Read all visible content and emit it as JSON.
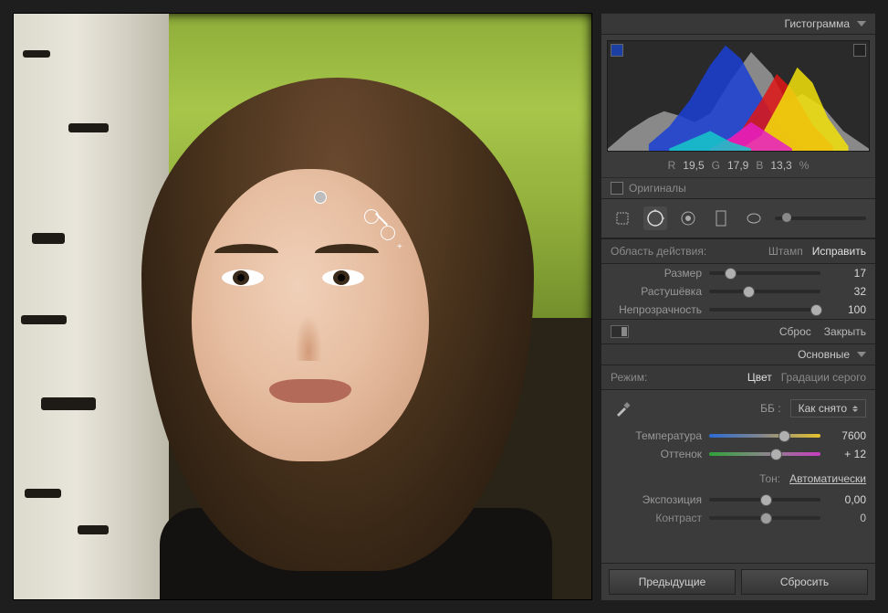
{
  "histogram": {
    "title": "Гистограмма",
    "readout": {
      "r_label": "R",
      "r": "19,5",
      "g_label": "G",
      "g": "17,9",
      "b_label": "B",
      "b": "13,3",
      "unit": "%"
    },
    "originals_label": "Оригиналы"
  },
  "tools": {
    "crop": "crop-tool",
    "spot": "spot-removal-tool",
    "redeye": "red-eye-tool",
    "grad": "graduated-filter-tool",
    "radial": "radial-filter-tool",
    "brush": "adjustment-brush-tool"
  },
  "spot_panel": {
    "scope_label": "Область действия:",
    "mode_clone": "Штамп",
    "mode_heal": "Исправить",
    "size_label": "Размер",
    "size_value": "17",
    "feather_label": "Растушёвка",
    "feather_value": "32",
    "opacity_label": "Непрозрачность",
    "opacity_value": "100",
    "reset": "Сброс",
    "close": "Закрыть"
  },
  "basic": {
    "title": "Основные",
    "treatment_label": "Режим:",
    "treatment_color": "Цвет",
    "treatment_bw": "Градации серого",
    "wb_label": "ББ :",
    "wb_value": "Как снято",
    "temp_label": "Температура",
    "temp_value": "7600",
    "tint_label": "Оттенок",
    "tint_value": "+ 12",
    "tone_label": "Тон:",
    "auto_label": "Автоматически",
    "exposure_label": "Экспозиция",
    "exposure_value": "0,00",
    "contrast_label": "Контраст",
    "contrast_value": "0"
  },
  "buttons": {
    "previous": "Предыдущие",
    "reset": "Сбросить"
  },
  "chart_data": {
    "type": "area",
    "title": "Гистограмма",
    "xlabel": "",
    "ylabel": "",
    "xlim": [
      0,
      255
    ],
    "ylim": [
      0,
      100
    ],
    "series": [
      {
        "name": "Luminance",
        "color": "#9a9a9a",
        "x": [
          0,
          20,
          40,
          55,
          70,
          85,
          100,
          120,
          140,
          160,
          175,
          190,
          210,
          230,
          255
        ],
        "values": [
          2,
          18,
          30,
          36,
          32,
          26,
          34,
          64,
          90,
          70,
          44,
          52,
          40,
          18,
          2
        ]
      },
      {
        "name": "Blue",
        "color": "#1a3fd6",
        "x": [
          40,
          60,
          80,
          100,
          115,
          130,
          150,
          170,
          190
        ],
        "values": [
          6,
          22,
          46,
          78,
          96,
          84,
          50,
          18,
          4
        ]
      },
      {
        "name": "Red",
        "color": "#e01515",
        "x": [
          110,
          130,
          150,
          165,
          180,
          200,
          220
        ],
        "values": [
          4,
          18,
          46,
          70,
          56,
          24,
          4
        ]
      },
      {
        "name": "Yellow",
        "color": "#f2e20a",
        "x": [
          130,
          150,
          170,
          185,
          200,
          215,
          235
        ],
        "values": [
          2,
          14,
          48,
          76,
          62,
          30,
          4
        ]
      },
      {
        "name": "Magenta",
        "color": "#e61fc6",
        "x": [
          100,
          120,
          140,
          160,
          180
        ],
        "values": [
          2,
          12,
          26,
          14,
          2
        ]
      },
      {
        "name": "Cyan",
        "color": "#16c8c8",
        "x": [
          60,
          80,
          100,
          120,
          140
        ],
        "values": [
          2,
          10,
          18,
          8,
          2
        ]
      }
    ]
  }
}
